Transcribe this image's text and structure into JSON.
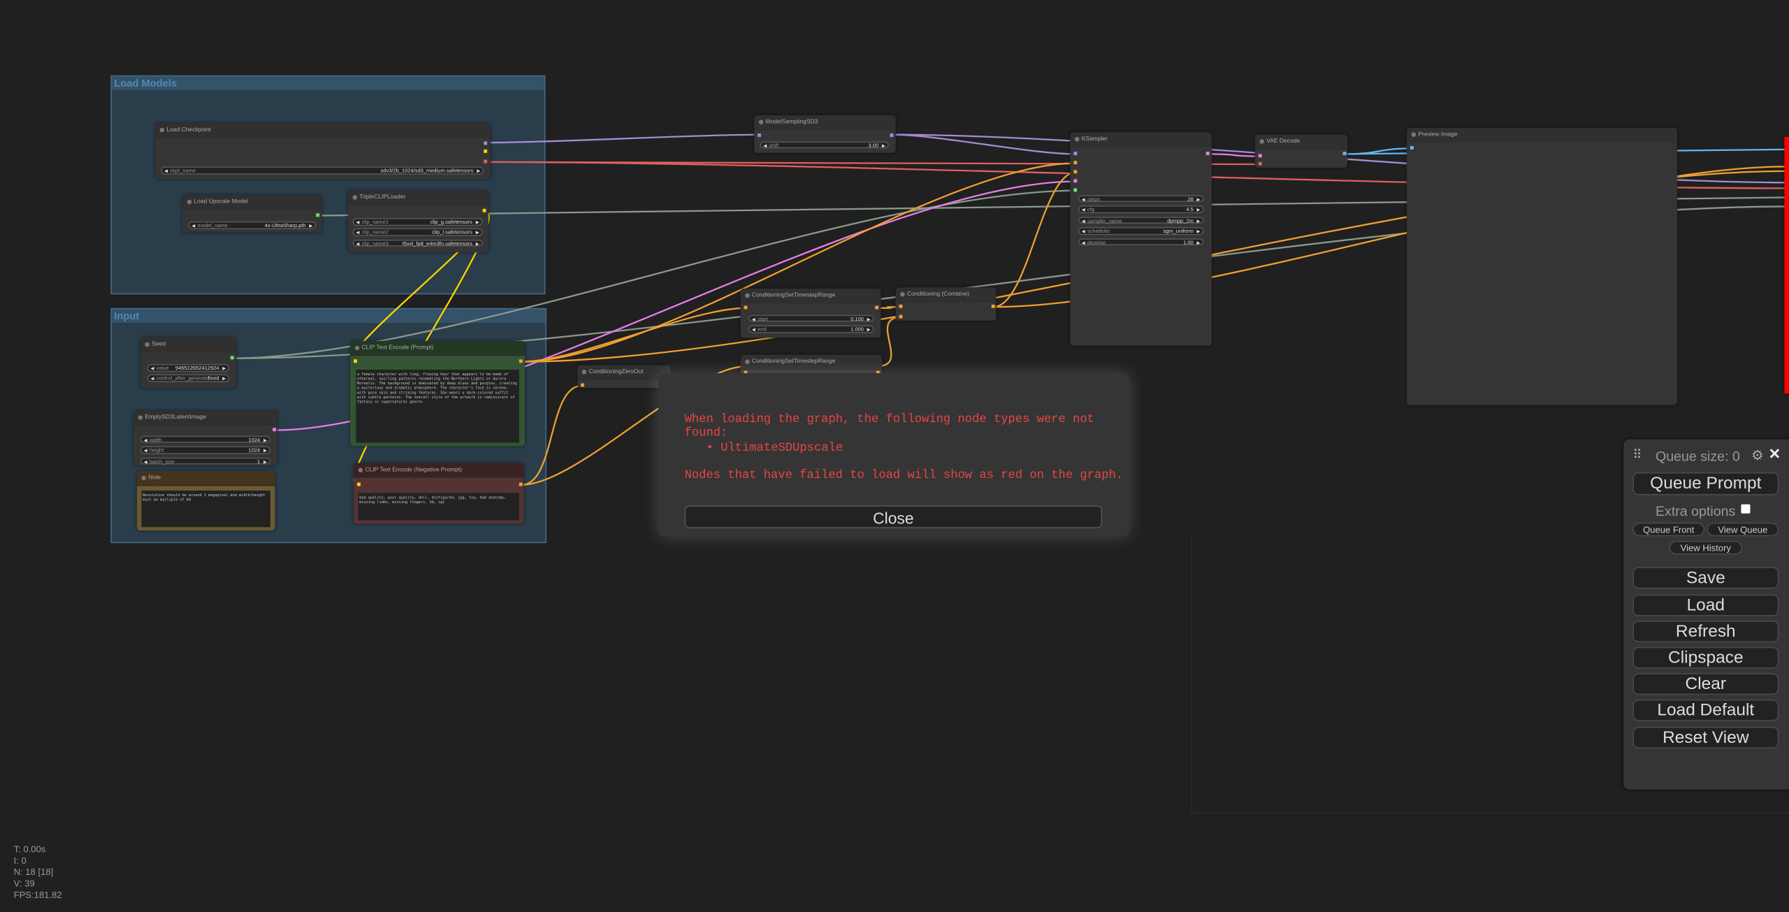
{
  "groups": {
    "load_models": "Load Models",
    "input": "Input"
  },
  "nodes": {
    "load_checkpoint": {
      "title": "Load Checkpoint",
      "widgets": [
        {
          "name": "ckpt_name",
          "value": "sdv3/2b_1024/sd3_medium.safetensors"
        }
      ]
    },
    "load_upscale_model": {
      "title": "Load Upscale Model",
      "widgets": [
        {
          "name": "model_name",
          "value": "4x-UltraSharp.pth"
        }
      ]
    },
    "triple_clip_loader": {
      "title": "TripleCLIPLoader",
      "widgets": [
        {
          "name": "clip_name1",
          "value": "clip_g.safetensors"
        },
        {
          "name": "clip_name2",
          "value": "clip_l.safetensors"
        },
        {
          "name": "clip_name3",
          "value": "t5xxl_fp8_e4m3fn.safetensors"
        }
      ]
    },
    "seed": {
      "title": "Seed",
      "widgets": [
        {
          "name": "value",
          "value": "945512652412924"
        },
        {
          "name": "control_after_generate",
          "value": "fixed"
        }
      ]
    },
    "empty_latent": {
      "title": "EmptySD3LatentImage",
      "widgets": [
        {
          "name": "width",
          "value": "1024"
        },
        {
          "name": "height",
          "value": "1024"
        },
        {
          "name": "batch_size",
          "value": "1"
        }
      ]
    },
    "note": {
      "title": "Note",
      "text": "Resolution should be around 1 megapixel and width/height must be multiple of 64"
    },
    "clip_positive": {
      "title": "CLIP Text Encode (Prompt)",
      "text": "a female character with long, flowing hair that appears to be made of ethereal, swirling patterns resembling the Northern Lights or Aurora Borealis. The background is dominated by deep blues and purples, creating a mysterious and dramatic atmosphere. The character's face is serene, with pale skin and striking features. She wears a dark-colored outfit with subtle patterns. The overall style of the artwork is reminiscent of fantasy or supernatural genres"
    },
    "clip_negative": {
      "title": "CLIP Text Encode (Negative Prompt)",
      "text": "bad quality, poor quality, doll, disfigured, jpg, toy, bad anatomy, missing limbs, missing fingers, 3d, cgi"
    },
    "model_sampling": {
      "title": "ModelSamplingSD3",
      "widgets": [
        {
          "name": "shift",
          "value": "3.00"
        }
      ]
    },
    "timestep_range_1": {
      "title": "ConditioningSetTimestepRange",
      "widgets": [
        {
          "name": "start",
          "value": "0.100"
        },
        {
          "name": "end",
          "value": "1.000"
        }
      ]
    },
    "timestep_range_2": {
      "title": "ConditioningSetTimestepRange"
    },
    "combine": {
      "title": "Conditioning (Combine)"
    },
    "zero_out": {
      "title": "ConditioningZeroOut"
    },
    "ksampler": {
      "title": "KSampler",
      "widgets": [
        {
          "name": "steps",
          "value": "28"
        },
        {
          "name": "cfg",
          "value": "4.5"
        },
        {
          "name": "sampler_name",
          "value": "dpmpp_2m"
        },
        {
          "name": "scheduler",
          "value": "sgm_uniform"
        },
        {
          "name": "denoise",
          "value": "1.00"
        }
      ]
    },
    "vae_decode": {
      "title": "VAE Decode"
    },
    "preview_image": {
      "title": "Preview Image"
    }
  },
  "dialog": {
    "message": "When loading the graph, the following node types were not found:",
    "missing": [
      "UltimateSDUpscale"
    ],
    "note": "Nodes that have failed to load will show as red on the graph.",
    "close_label": "Close",
    "text_color": "#e84545"
  },
  "queue_panel": {
    "queue_size": "Queue size: 0",
    "queue_prompt": "Queue Prompt",
    "extra_options": "Extra options",
    "extra_options_checked": false,
    "queue_front": "Queue Front",
    "view_queue": "View Queue",
    "view_history": "View History",
    "buttons": [
      "Save",
      "Load",
      "Refresh",
      "Clipspace",
      "Clear",
      "Load Default",
      "Reset View"
    ]
  },
  "stats": {
    "t": "T: 0.00s",
    "i": "I: 0",
    "n": "N: 18 [18]",
    "v": "V: 39",
    "fps": "FPS:181.82"
  },
  "link_colors": {
    "model": "#a58bd6",
    "clip": "#ffd500",
    "vae": "#e06060",
    "conditioning": "#f0a030",
    "latent": "#e67ee6",
    "int": "#8a9a8a",
    "image": "#64b5f6"
  }
}
